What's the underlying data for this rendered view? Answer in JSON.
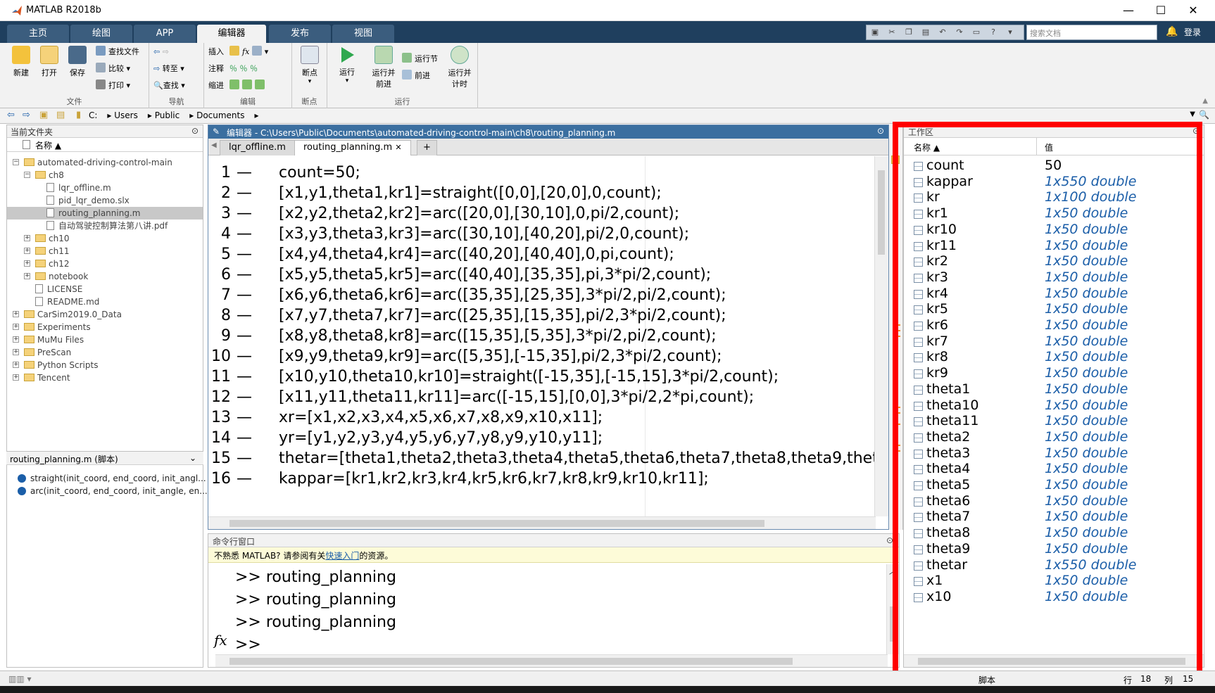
{
  "window": {
    "title": "MATLAB R2018b",
    "controls": {
      "minimize": "—",
      "maximize": "☐",
      "close": "✕"
    }
  },
  "ribbon_tabs": [
    "主页",
    "绘图",
    "APP",
    "编辑器",
    "发布",
    "视图"
  ],
  "active_ribbon_tab": "编辑器",
  "search_docs": {
    "placeholder": "搜索文档"
  },
  "login_label": "登录",
  "toolstrip": {
    "file": {
      "label": "文件",
      "new": "新建",
      "open": "打开",
      "save": "保存",
      "find_files": "查找文件",
      "compare": "比较",
      "print": "打印"
    },
    "navigate": {
      "label": "导航",
      "goto": "转至",
      "find": "查找"
    },
    "edit": {
      "label": "编辑",
      "insert": "插入",
      "comment": "注释",
      "indent": "缩进",
      "fx": "fx"
    },
    "breakpoints": {
      "label": "断点",
      "breakpoints": "断点"
    },
    "run": {
      "label": "运行",
      "run": "运行",
      "run_advance_1": "运行并",
      "run_advance_2": "前进",
      "run_section": "运行节",
      "advance": "前进",
      "run_time_1": "运行并",
      "run_time_2": "计时"
    }
  },
  "address_bar": {
    "path": [
      "C:",
      "Users",
      "Public",
      "Documents"
    ]
  },
  "current_folder": {
    "title": "当前文件夹",
    "column": "名称",
    "items": [
      {
        "name": "automated-driving-control-main",
        "type": "folder",
        "level": 0,
        "expander": "−"
      },
      {
        "name": "ch8",
        "type": "folder",
        "level": 1,
        "expander": "−"
      },
      {
        "name": "lqr_offline.m",
        "type": "file",
        "level": 2
      },
      {
        "name": "pid_lqr_demo.slx",
        "type": "file",
        "level": 2
      },
      {
        "name": "routing_planning.m",
        "type": "file",
        "level": 2,
        "selected": true
      },
      {
        "name": "自动驾驶控制算法第八讲.pdf",
        "type": "file",
        "level": 2
      },
      {
        "name": "ch10",
        "type": "folder",
        "level": 1,
        "expander": "+"
      },
      {
        "name": "ch11",
        "type": "folder",
        "level": 1,
        "expander": "+"
      },
      {
        "name": "ch12",
        "type": "folder",
        "level": 1,
        "expander": "+"
      },
      {
        "name": "notebook",
        "type": "folder",
        "level": 1,
        "expander": "+"
      },
      {
        "name": "LICENSE",
        "type": "file",
        "level": 1
      },
      {
        "name": "README.md",
        "type": "file",
        "level": 1
      },
      {
        "name": "CarSim2019.0_Data",
        "type": "folder",
        "level": 0,
        "expander": "+"
      },
      {
        "name": "Experiments",
        "type": "folder",
        "level": 0,
        "expander": "+"
      },
      {
        "name": "MuMu Files",
        "type": "folder",
        "level": 0,
        "expander": "+"
      },
      {
        "name": "PreScan",
        "type": "folder",
        "level": 0,
        "expander": "+"
      },
      {
        "name": "Python Scripts",
        "type": "folder",
        "level": 0,
        "expander": "+"
      },
      {
        "name": "Tencent",
        "type": "folder",
        "level": 0,
        "expander": "+"
      }
    ]
  },
  "details": {
    "title": "routing_planning.m  (脚本)",
    "functions": [
      "straight(init_coord, end_coord, init_angl...",
      "arc(init_coord, end_coord, init_angle, en..."
    ]
  },
  "editor": {
    "title": "编辑器 - C:\\Users\\Public\\Documents\\automated-driving-control-main\\ch8\\routing_planning.m",
    "tabs": [
      "lqr_offline.m",
      "routing_planning.m"
    ],
    "active_tab": "routing_planning.m",
    "add_tab": "+",
    "lines": [
      "count=50;",
      "[x1,y1,theta1,kr1]=straight([0,0],[20,0],0,count);",
      "[x2,y2,theta2,kr2]=arc([20,0],[30,10],0,pi/2,count);",
      "[x3,y3,theta3,kr3]=arc([30,10],[40,20],pi/2,0,count);",
      "[x4,y4,theta4,kr4]=arc([40,20],[40,40],0,pi,count);",
      "[x5,y5,theta5,kr5]=arc([40,40],[35,35],pi,3*pi/2,count);",
      "[x6,y6,theta6,kr6]=arc([35,35],[25,35],3*pi/2,pi/2,count);",
      "[x7,y7,theta7,kr7]=arc([25,35],[15,35],pi/2,3*pi/2,count);",
      "[x8,y8,theta8,kr8]=arc([15,35],[5,35],3*pi/2,pi/2,count);",
      "[x9,y9,theta9,kr9]=arc([5,35],[-15,35],pi/2,3*pi/2,count);",
      "[x10,y10,theta10,kr10]=straight([-15,35],[-15,15],3*pi/2,count);",
      "[x11,y11,theta11,kr11]=arc([-15,15],[0,0],3*pi/2,2*pi,count);",
      "xr=[x1,x2,x3,x4,x5,x6,x7,x8,x9,x10,x11];",
      "yr=[y1,y2,y3,y4,y5,y6,y7,y8,y9,y10,y11];",
      "thetar=[theta1,theta2,theta3,theta4,theta5,theta6,theta7,theta8,theta9,thet",
      "kappar=[kr1,kr2,kr3,kr4,kr5,kr6,kr7,kr8,kr9,kr10,kr11];"
    ]
  },
  "command_window": {
    "title": "命令行窗口",
    "hint_prefix": "不熟悉 MATLAB? 请参阅有关",
    "hint_link": "快速入门",
    "hint_suffix": "的资源。",
    "history": [
      ">> routing_planning",
      ">> routing_planning",
      ">> routing_planning"
    ],
    "prompt": ">>",
    "fx": "fx"
  },
  "workspace": {
    "title": "工作区",
    "col_name": "名称",
    "col_value": "值",
    "vars": [
      {
        "name": "count",
        "value": "50"
      },
      {
        "name": "kappar",
        "value": "1x550 double"
      },
      {
        "name": "kr",
        "value": "1x100 double"
      },
      {
        "name": "kr1",
        "value": "1x50 double"
      },
      {
        "name": "kr10",
        "value": "1x50 double"
      },
      {
        "name": "kr11",
        "value": "1x50 double"
      },
      {
        "name": "kr2",
        "value": "1x50 double"
      },
      {
        "name": "kr3",
        "value": "1x50 double"
      },
      {
        "name": "kr4",
        "value": "1x50 double"
      },
      {
        "name": "kr5",
        "value": "1x50 double"
      },
      {
        "name": "kr6",
        "value": "1x50 double"
      },
      {
        "name": "kr7",
        "value": "1x50 double"
      },
      {
        "name": "kr8",
        "value": "1x50 double"
      },
      {
        "name": "kr9",
        "value": "1x50 double"
      },
      {
        "name": "theta1",
        "value": "1x50 double"
      },
      {
        "name": "theta10",
        "value": "1x50 double"
      },
      {
        "name": "theta11",
        "value": "1x50 double"
      },
      {
        "name": "theta2",
        "value": "1x50 double"
      },
      {
        "name": "theta3",
        "value": "1x50 double"
      },
      {
        "name": "theta4",
        "value": "1x50 double"
      },
      {
        "name": "theta5",
        "value": "1x50 double"
      },
      {
        "name": "theta6",
        "value": "1x50 double"
      },
      {
        "name": "theta7",
        "value": "1x50 double"
      },
      {
        "name": "theta8",
        "value": "1x50 double"
      },
      {
        "name": "theta9",
        "value": "1x50 double"
      },
      {
        "name": "thetar",
        "value": "1x550 double"
      },
      {
        "name": "x1",
        "value": "1x50 double"
      },
      {
        "name": "x10",
        "value": "1x50 double"
      }
    ]
  },
  "status": {
    "mode": "脚本",
    "row_label": "行",
    "row": "18",
    "col_label": "列",
    "col": "15"
  },
  "colors": {
    "highlight_box": "#ff0000",
    "tab_strip": "#1f3f5e",
    "link": "#1b5ea8"
  }
}
